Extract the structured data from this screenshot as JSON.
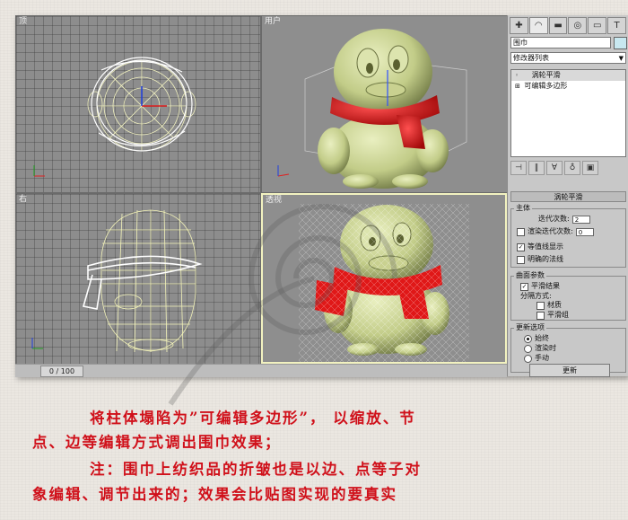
{
  "viewports": {
    "top": {
      "label": "顶"
    },
    "user": {
      "label": "用户"
    },
    "right": {
      "label": "右"
    },
    "perspective": {
      "label": "透视"
    }
  },
  "timeline": {
    "slider_text": "0 / 100"
  },
  "panel": {
    "tabs": [
      "✚",
      "◠",
      "▬",
      "◎",
      "▭",
      "T"
    ],
    "object_name": "围巾",
    "modifier_list": "修改器列表",
    "stack": [
      "涡轮平滑",
      "可编辑多边形"
    ],
    "turbosmooth": {
      "title": "涡轮平滑",
      "main_group": "主体",
      "iterations_label": "迭代次数:",
      "iterations_value": "2",
      "render_iters_label": "渲染迭代次数:",
      "render_iters_value": "0",
      "isoline_label": "等值线显示",
      "explicit_normals_label": "明确的法线",
      "surface_group": "曲面参数",
      "smooth_result_label": "平滑结果",
      "separate_label": "分隔方式:",
      "material_label": "材质",
      "smoothing_group_label": "平滑组",
      "update_group": "更新选项",
      "always_label": "始终",
      "when_rendering_label": "渲染时",
      "manually_label": "手动",
      "update_button": "更新"
    }
  },
  "caption": {
    "line1": "将柱体塌陷为”可编辑多边形”， 以缩放、节",
    "line2": "点、边等编辑方式调出围巾效果；",
    "line3": "注：围巾上纺织品的折皱也是以边、点等子对",
    "line4": "象编辑、调节出来的；效果会比贴图实现的要真实"
  },
  "colors": {
    "caption_red": "#d0101a",
    "penguin_body": "#c6cf8e",
    "scarf_red": "#e01818",
    "wireframe": "#f3f3b8"
  }
}
